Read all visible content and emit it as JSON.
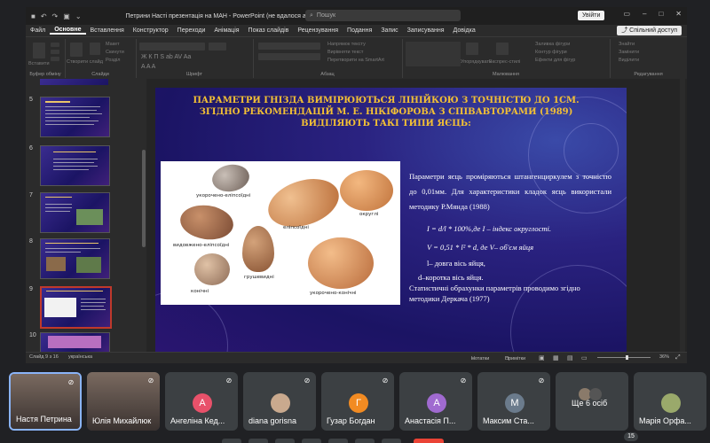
{
  "window": {
    "title": "Петрини Насті презентація на МАН  -  PowerPoint (не вдалося активувати продукт)",
    "search_label": "Пошук",
    "signin_label": "Увійти"
  },
  "menu": {
    "tabs": [
      "Файл",
      "Основне",
      "Вставлення",
      "Конструктор",
      "Переходи",
      "Анімація",
      "Показ слайдів",
      "Рецензування",
      "Подання",
      "Запис",
      "Записування",
      "Довідка"
    ],
    "share_label": "Спільний доступ"
  },
  "ribbon": {
    "groups": [
      "Буфер обміну",
      "Слайди",
      "Шрифт",
      "Абзац",
      "Малювання",
      "Редагування"
    ],
    "items": {
      "paste": "Вставити",
      "new_slide": "Створити слайд",
      "reuse": "Повторне використання",
      "layout": "Макет",
      "reset": "Скинути",
      "section": "Розділ",
      "text_dir": "Напрямок тексту",
      "align_text": "Вирівняти текст",
      "smartart": "Перетворити на SmartArt",
      "arrange": "Упорядкувати",
      "quick_styles": "Експрес-стилі",
      "fill": "Заливка фігури",
      "outline": "Контур фігури",
      "effects": "Ефекти для фігур",
      "find": "Знайти",
      "replace": "Замінити",
      "select": "Виділити"
    }
  },
  "thumbnails": [
    {
      "num": "5"
    },
    {
      "num": "6"
    },
    {
      "num": "7"
    },
    {
      "num": "8"
    },
    {
      "num": "9"
    },
    {
      "num": "10"
    }
  ],
  "slide": {
    "title": "ПАРАМЕТРИ ГНІЗДА ВИМІРЮЮТЬСЯ ЛІНІЙКОЮ З ТОЧНІСТЮ ДО 1СМ. ЗГІДНО РЕКОМЕНДАЦІЙ М. Е. НІКІФОРОВА З СПІВАВТОРАМИ (1989) ВИДІЛЯЮТЬ ТАКІ ТИПИ ЯЄЦЬ:",
    "egg_labels": {
      "short_elliptical": "укорочено-еліпсоїдні",
      "elliptical": "еліпсоїдні",
      "round": "округлі",
      "long_elliptical": "видовжено-еліпсоїдні",
      "pear": "грушевидні",
      "conical": "конічні",
      "short_conical": "укорочено-конічні"
    },
    "p1": "Параметри яєць проміряються штангенциркулем з точністю до 0,01мм. Для характеристики кладок яєць використали методику Р.Мянда (1988)",
    "formula1": "I = d/l * 100%,де   I – індекс округлості.",
    "formula2": "V = 0,51 * l² * d, де V– об'єм яйця",
    "l_def": "l– довга вісь яйця,",
    "d_def": "d–коротка вісь яйця.",
    "p2": "Статистичні  обрахунки параметрів проводимо згідно методики Деркача (1977)"
  },
  "statusbar": {
    "slide_info": "Слайд 9 з 16",
    "language": "українська",
    "notes": "Нотатки",
    "comments": "Примітки",
    "zoom": "36%"
  },
  "participants": [
    {
      "name": "Настя Петрина",
      "initial": "",
      "color": "#5f6368",
      "video": true,
      "active": true
    },
    {
      "name": "Юлія Михайлюк",
      "initial": "",
      "color": "#5f6368",
      "video": true,
      "active": false
    },
    {
      "name": "Ангеліна Кед...",
      "initial": "А",
      "color": "#e8516a",
      "video": false,
      "active": false
    },
    {
      "name": "diana gorisna",
      "initial": "",
      "color": "#c9a98e",
      "video": false,
      "active": false
    },
    {
      "name": "Гузар Богдан",
      "initial": "Г",
      "color": "#f28b22",
      "video": false,
      "active": false
    },
    {
      "name": "Анастасія П...",
      "initial": "А",
      "color": "#a06ad0",
      "video": false,
      "active": false
    },
    {
      "name": "Максим Ста...",
      "initial": "М",
      "color": "#6b7b8c",
      "video": false,
      "active": false
    },
    {
      "name": "Ще 6 осіб",
      "initial": "",
      "color": "#5f6368",
      "video": false,
      "active": false
    },
    {
      "name": "Марія Орфа...",
      "initial": "",
      "color": "#9aa96b",
      "video": false,
      "active": false
    }
  ],
  "more_count": "15"
}
